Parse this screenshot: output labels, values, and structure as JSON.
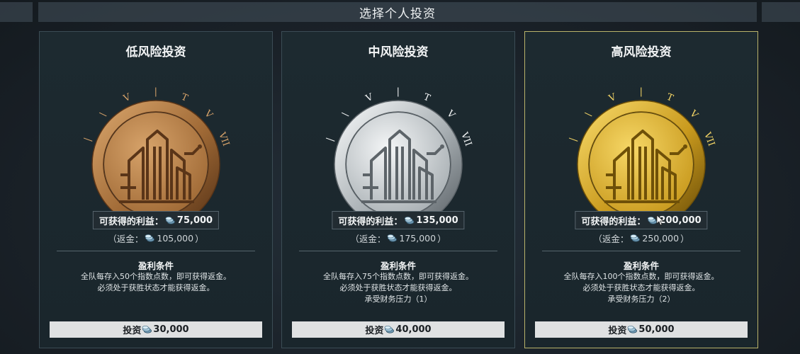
{
  "header": {
    "title": "选择个人投资"
  },
  "cards": [
    {
      "title": "低风险投资",
      "profit_label": "可获得的利益：",
      "profit_value": "75,000",
      "rebate_prefix": "（返金：",
      "rebate_value": "105,000",
      "rebate_suffix": "）",
      "condition_title": "盈利条件",
      "condition_lines": [
        "全队每存入50个指数点数，即可获得返金。",
        "必须处于获胜状态才能获得返金。",
        ""
      ],
      "button_label": "投资",
      "button_value": "30,000",
      "emblem_theme": "bronze",
      "emblem_colors": {
        "light": "#d7a36a",
        "mid": "#a06a36",
        "dark": "#5a3518"
      }
    },
    {
      "title": "中风险投资",
      "profit_label": "可获得的利益：",
      "profit_value": "135,000",
      "rebate_prefix": "（返金：",
      "rebate_value": "175,000",
      "rebate_suffix": "）",
      "condition_title": "盈利条件",
      "condition_lines": [
        "全队每存入75个指数点数，即可获得返金。",
        "必须处于获胜状态才能获得返金。",
        "承受财务压力（1）"
      ],
      "button_label": "投资",
      "button_value": "40,000",
      "emblem_theme": "silver",
      "emblem_colors": {
        "light": "#f4f6f7",
        "mid": "#a9b0b4",
        "dark": "#5d6469"
      }
    },
    {
      "title": "高风险投资",
      "profit_label": "可获得的利益：",
      "profit_value": "200,000",
      "rebate_prefix": "（返金：",
      "rebate_value": "250,000",
      "rebate_suffix": "）",
      "condition_title": "盈利条件",
      "condition_lines": [
        "全队每存入100个指数点数，即可获得返金。",
        "必须处于获胜状态才能获得返金。",
        "承受财务压力（2）"
      ],
      "button_label": "投资",
      "button_value": "50,000",
      "emblem_theme": "gold",
      "emblem_colors": {
        "light": "#f6d766",
        "mid": "#c99a1e",
        "dark": "#6e5008"
      }
    }
  ],
  "colors": {
    "selected_border": "#b9b36a",
    "card_border": "#3b4c55",
    "button_bg": "#dfe1e2"
  },
  "icons": {
    "chip": "chip-icon",
    "cursor": "cursor-icon"
  }
}
